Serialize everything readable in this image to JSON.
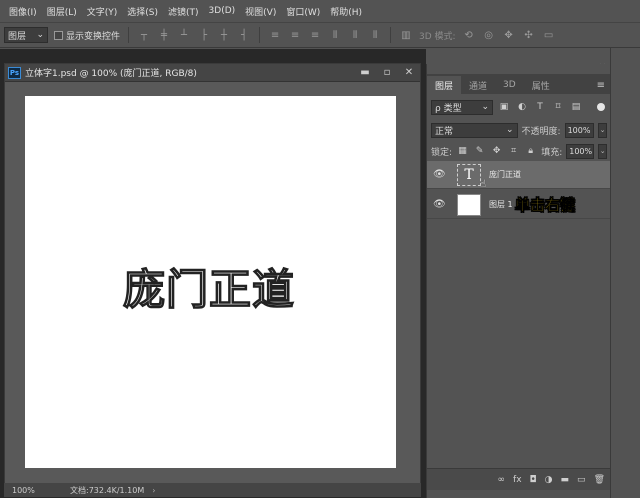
{
  "menu": [
    "图像(I)",
    "图层(L)",
    "文字(Y)",
    "选择(S)",
    "滤镜(T)",
    "3D(D)",
    "视图(V)",
    "窗口(W)",
    "帮助(H)"
  ],
  "options": {
    "tool_select": "图层",
    "show_transform": "显示变换控件",
    "mode3d": "3D 模式:"
  },
  "document": {
    "badge": "Ps",
    "title": "立体字1.psd @ 100% (庞门正道, RGB/8)",
    "canvas_text": "庞门正道",
    "zoom": "100%",
    "doc_info": "文档:732.4K/1.10M",
    "arrow": "›"
  },
  "panel": {
    "collapse": "«",
    "tabs": [
      "图层",
      "通道",
      "3D",
      "属性"
    ],
    "menu_icon": "≡",
    "filter": "ρ 类型",
    "blend": "正常",
    "opacity_label": "不透明度:",
    "opacity": "100%",
    "lock_label": "锁定:",
    "fill_label": "填充:",
    "fill": "100%",
    "layers": [
      {
        "name": "庞门正道",
        "thumb": "T"
      },
      {
        "name": "图层 1",
        "thumb": ""
      }
    ],
    "annotation": "单击右键",
    "bottom_icons": [
      "∞",
      "fx",
      "◘",
      "◑",
      "▬",
      "▭",
      "🗑"
    ]
  }
}
